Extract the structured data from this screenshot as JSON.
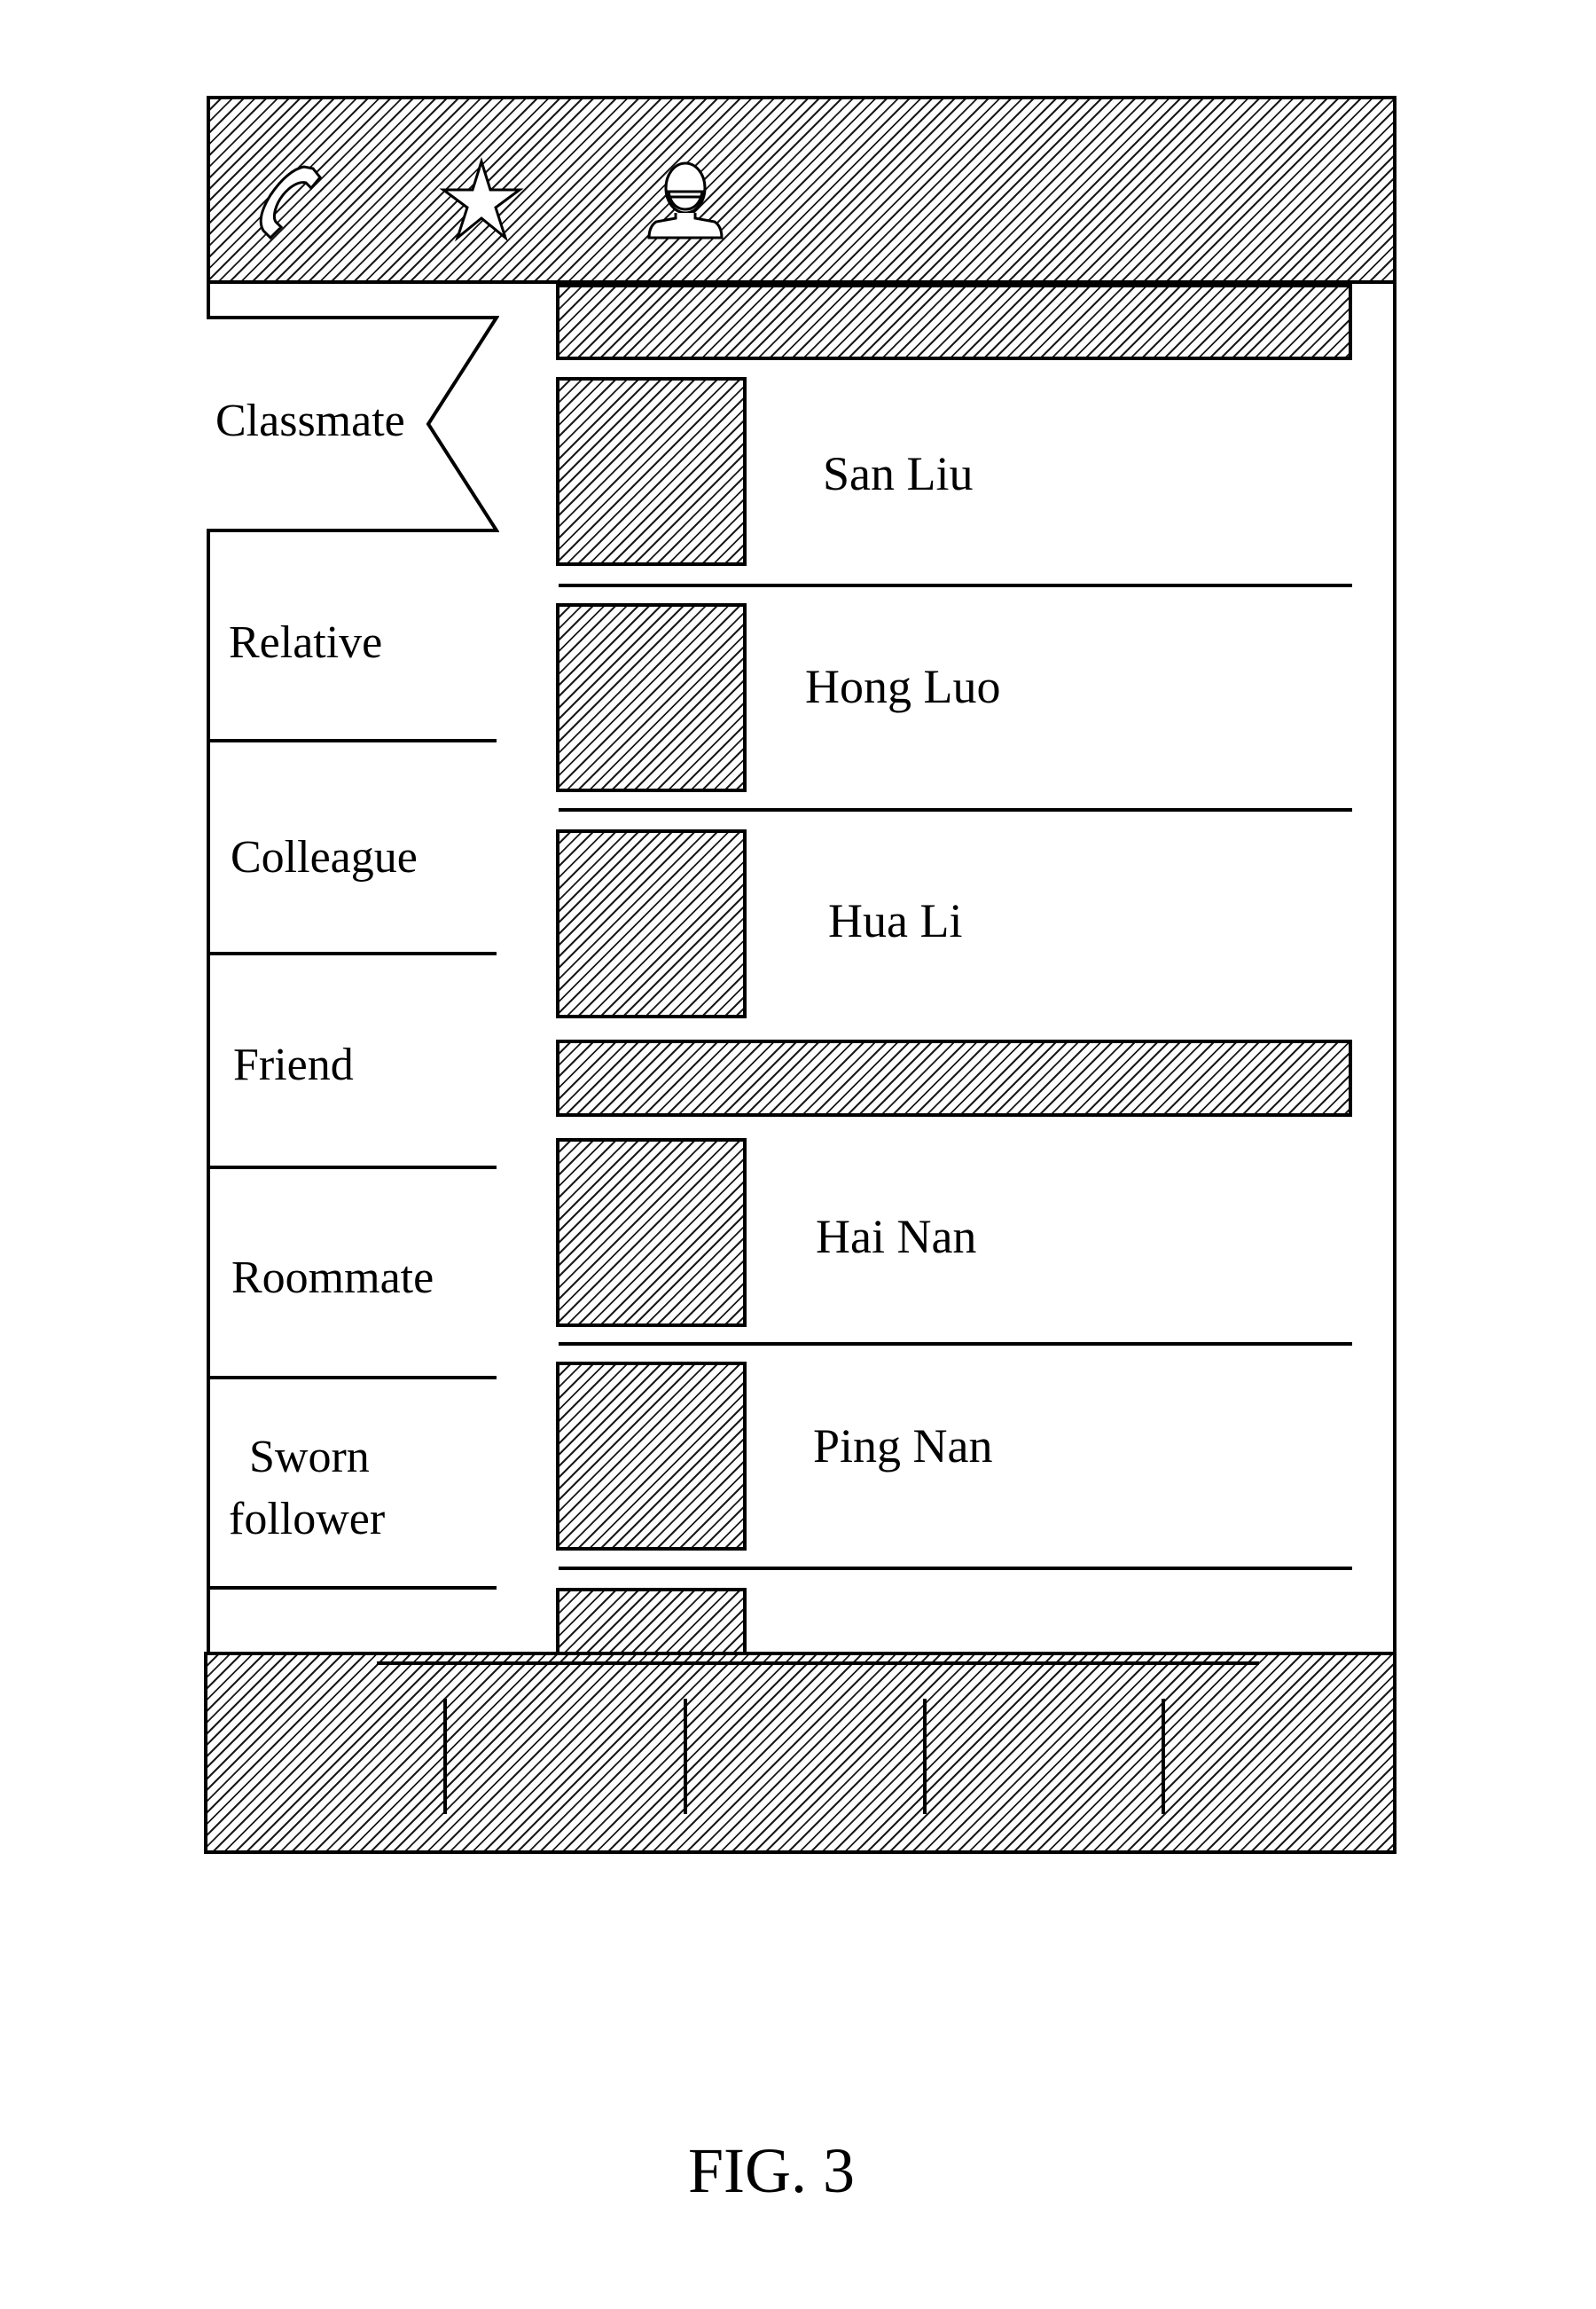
{
  "header": {
    "icons": [
      {
        "name": "phone-icon",
        "label": "Calls"
      },
      {
        "name": "star-icon",
        "label": "Favorites"
      },
      {
        "name": "contacts-icon",
        "label": "Contacts"
      }
    ]
  },
  "sidebar": {
    "selected_index": 0,
    "groups": [
      {
        "label": "Classmate"
      },
      {
        "label": "Relative"
      },
      {
        "label": "Colleague"
      },
      {
        "label": "Friend"
      },
      {
        "label": "Roommate"
      },
      {
        "label": "Sworn follower",
        "line1": "Sworn",
        "line2": "follower"
      }
    ]
  },
  "contacts": {
    "search_bar": {
      "placeholder": ""
    },
    "section_one": [
      {
        "name": "San Liu"
      },
      {
        "name": "Hong Luo"
      },
      {
        "name": "Hua Li"
      }
    ],
    "section_two": [
      {
        "name": "Hai Nan"
      },
      {
        "name": "Ping Nan"
      }
    ]
  },
  "footer": {
    "tab_count": 5
  },
  "caption": "FIG. 3"
}
